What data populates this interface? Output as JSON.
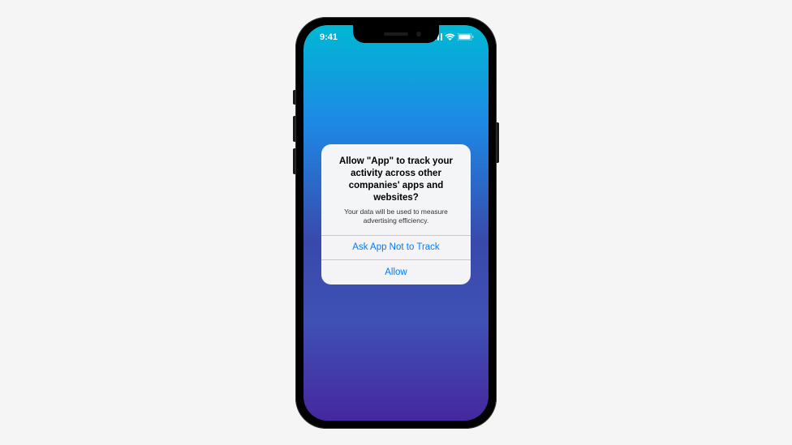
{
  "statusbar": {
    "time": "9:41"
  },
  "alert": {
    "title": "Allow \"App\" to track your activity across other companies' apps and websites?",
    "message": "Your data will be used to measure advertising efficiency.",
    "deny_label": "Ask App Not to Track",
    "allow_label": "Allow"
  }
}
